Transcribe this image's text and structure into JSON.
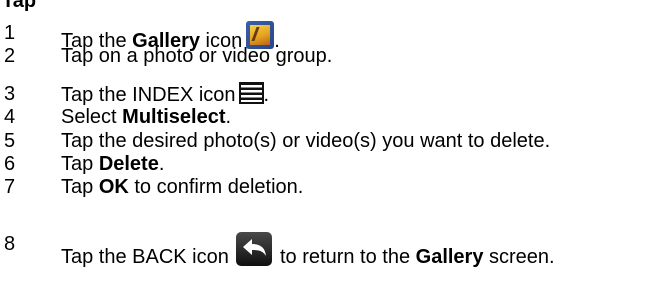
{
  "heading": "Tap",
  "steps": [
    {
      "num": "1",
      "pre": "Tap the ",
      "bold": "Gallery",
      "post": " icon",
      "tail": "."
    },
    {
      "num": "2",
      "text": "Tap on a photo or video group."
    },
    {
      "num": "3",
      "pre": "Tap the INDEX icon",
      "tail": "."
    },
    {
      "num": "4",
      "pre": "Select ",
      "bold": "Multiselect",
      "post": "."
    },
    {
      "num": "5",
      "text": "Tap the desired photo(s) or video(s) you want to delete."
    },
    {
      "num": "6",
      "pre": "Tap ",
      "bold": "Delete",
      "post": "."
    },
    {
      "num": "7",
      "pre": "Tap ",
      "bold": "OK",
      "post": " to confirm deletion."
    },
    {
      "num": "8",
      "pre": "Tap the BACK icon ",
      "post": " to return to the ",
      "bold": "Gallery",
      "tail": " screen."
    }
  ],
  "icons": {
    "gallery": "gallery-icon",
    "index": "index-menu-icon",
    "back": "back-arrow-icon"
  }
}
